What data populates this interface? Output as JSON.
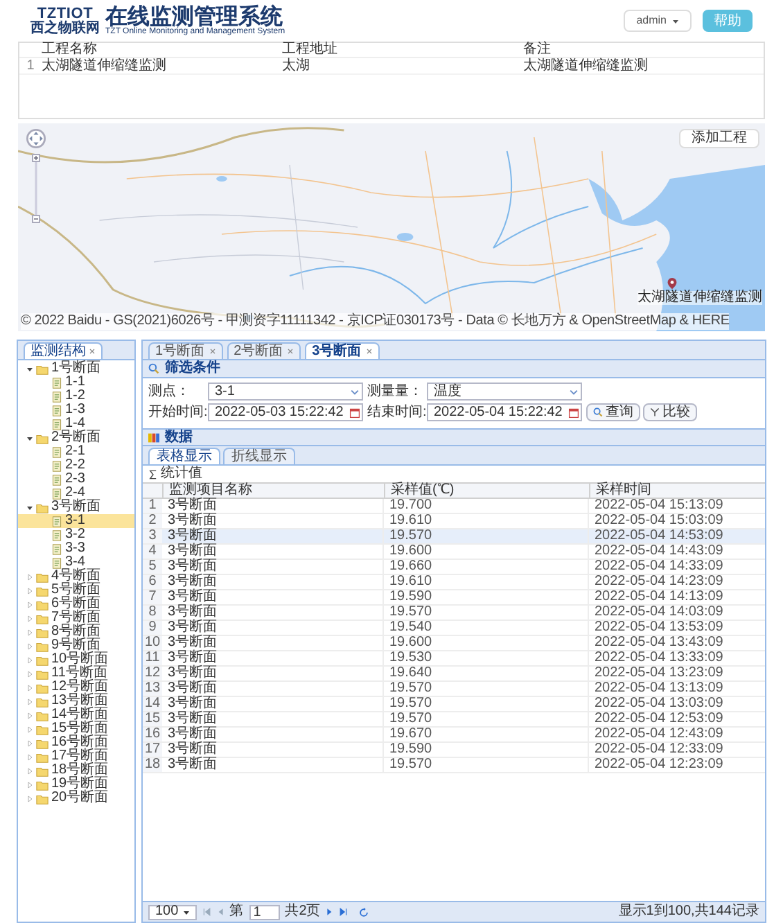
{
  "header": {
    "brand": "TZTIOT",
    "brand_sub": "西之物联网",
    "title": "在线监测管理系统",
    "subtitle": "TZT Online Monitoring and Management System",
    "user_menu": "admin",
    "help_button": "帮助"
  },
  "projects": {
    "columns": [
      "工程名称",
      "工程地址",
      "备注"
    ],
    "rows": [
      {
        "index": "1",
        "cells": [
          "太湖隧道伸缩缝监测",
          "太湖",
          "太湖隧道伸缩缝监测"
        ]
      }
    ]
  },
  "map": {
    "add_button": "添加工程",
    "marker_label": "太湖隧道伸缩缝监测",
    "copyright": "© 2022 Baidu - GS(2021)6026号 - 甲测资字11111342 - 京ICP证030173号 - Data © 长地万方 & OpenStreetMap & HERE"
  },
  "sidebar": {
    "tab": "监测结构",
    "tree": [
      {
        "label": "1号断面",
        "expanded": true,
        "children": [
          {
            "label": "1-1",
            "selected": false
          },
          {
            "label": "1-2",
            "selected": false
          },
          {
            "label": "1-3",
            "selected": false
          },
          {
            "label": "1-4",
            "selected": false
          }
        ]
      },
      {
        "label": "2号断面",
        "expanded": true,
        "children": [
          {
            "label": "2-1",
            "selected": false
          },
          {
            "label": "2-2",
            "selected": false
          },
          {
            "label": "2-3",
            "selected": false
          },
          {
            "label": "2-4",
            "selected": false
          }
        ]
      },
      {
        "label": "3号断面",
        "expanded": true,
        "children": [
          {
            "label": "3-1",
            "selected": true
          },
          {
            "label": "3-2",
            "selected": false
          },
          {
            "label": "3-3",
            "selected": false
          },
          {
            "label": "3-4",
            "selected": false
          }
        ]
      },
      {
        "label": "4号断面",
        "expanded": false
      },
      {
        "label": "5号断面",
        "expanded": false
      },
      {
        "label": "6号断面",
        "expanded": false
      },
      {
        "label": "7号断面",
        "expanded": false
      },
      {
        "label": "8号断面",
        "expanded": false
      },
      {
        "label": "9号断面",
        "expanded": false
      },
      {
        "label": "10号断面",
        "expanded": false
      },
      {
        "label": "11号断面",
        "expanded": false
      },
      {
        "label": "12号断面",
        "expanded": false
      },
      {
        "label": "13号断面",
        "expanded": false
      },
      {
        "label": "14号断面",
        "expanded": false
      },
      {
        "label": "15号断面",
        "expanded": false
      },
      {
        "label": "16号断面",
        "expanded": false
      },
      {
        "label": "17号断面",
        "expanded": false
      },
      {
        "label": "18号断面",
        "expanded": false
      },
      {
        "label": "19号断面",
        "expanded": false
      },
      {
        "label": "20号断面",
        "expanded": false
      }
    ]
  },
  "tabs": [
    {
      "label": "1号断面",
      "selected": false
    },
    {
      "label": "2号断面",
      "selected": false
    },
    {
      "label": "3号断面",
      "selected": true
    }
  ],
  "filter": {
    "title": "筛选条件",
    "fields": [
      {
        "label": "测点：",
        "value": "3-1",
        "kind": "select"
      },
      {
        "label": "测量量：",
        "value": "温度",
        "kind": "select"
      },
      {
        "label": "开始时间:",
        "value": "2022-05-03 15:22:42",
        "kind": "date"
      },
      {
        "label": "结束时间:",
        "value": "2022-05-04 15:22:42",
        "kind": "date"
      }
    ],
    "buttons": [
      {
        "label": "查询",
        "kind": "search"
      },
      {
        "label": "比较",
        "kind": "compare"
      }
    ]
  },
  "data": {
    "title": "数据",
    "view_tabs": [
      {
        "label": "表格显示",
        "selected": true
      },
      {
        "label": "折线显示",
        "selected": false
      }
    ],
    "stats_button": "统计值",
    "columns": [
      "监测项目名称",
      "采样值(℃)",
      "采样时间"
    ],
    "rows": [
      {
        "index": "1",
        "name": "3号断面",
        "value": "19.700",
        "time": "2022-05-04 15:13:09",
        "selected": false
      },
      {
        "index": "2",
        "name": "3号断面",
        "value": "19.610",
        "time": "2022-05-04 15:03:09",
        "selected": false
      },
      {
        "index": "3",
        "name": "3号断面",
        "value": "19.570",
        "time": "2022-05-04 14:53:09",
        "selected": true
      },
      {
        "index": "4",
        "name": "3号断面",
        "value": "19.600",
        "time": "2022-05-04 14:43:09",
        "selected": false
      },
      {
        "index": "5",
        "name": "3号断面",
        "value": "19.660",
        "time": "2022-05-04 14:33:09",
        "selected": false
      },
      {
        "index": "6",
        "name": "3号断面",
        "value": "19.610",
        "time": "2022-05-04 14:23:09",
        "selected": false
      },
      {
        "index": "7",
        "name": "3号断面",
        "value": "19.590",
        "time": "2022-05-04 14:13:09",
        "selected": false
      },
      {
        "index": "8",
        "name": "3号断面",
        "value": "19.570",
        "time": "2022-05-04 14:03:09",
        "selected": false
      },
      {
        "index": "9",
        "name": "3号断面",
        "value": "19.540",
        "time": "2022-05-04 13:53:09",
        "selected": false
      },
      {
        "index": "10",
        "name": "3号断面",
        "value": "19.600",
        "time": "2022-05-04 13:43:09",
        "selected": false
      },
      {
        "index": "11",
        "name": "3号断面",
        "value": "19.530",
        "time": "2022-05-04 13:33:09",
        "selected": false
      },
      {
        "index": "12",
        "name": "3号断面",
        "value": "19.640",
        "time": "2022-05-04 13:23:09",
        "selected": false
      },
      {
        "index": "13",
        "name": "3号断面",
        "value": "19.570",
        "time": "2022-05-04 13:13:09",
        "selected": false
      },
      {
        "index": "14",
        "name": "3号断面",
        "value": "19.570",
        "time": "2022-05-04 13:03:09",
        "selected": false
      },
      {
        "index": "15",
        "name": "3号断面",
        "value": "19.570",
        "time": "2022-05-04 12:53:09",
        "selected": false
      },
      {
        "index": "16",
        "name": "3号断面",
        "value": "19.670",
        "time": "2022-05-04 12:43:09",
        "selected": false
      },
      {
        "index": "17",
        "name": "3号断面",
        "value": "19.590",
        "time": "2022-05-04 12:33:09",
        "selected": false
      },
      {
        "index": "18",
        "name": "3号断面",
        "value": "19.570",
        "time": "2022-05-04 12:23:09",
        "selected": false
      }
    ]
  },
  "pagination": {
    "page_size": "100",
    "page_prefix": "第",
    "page": "1",
    "page_total": "共2页",
    "summary": "显示1到100,共144记录"
  }
}
